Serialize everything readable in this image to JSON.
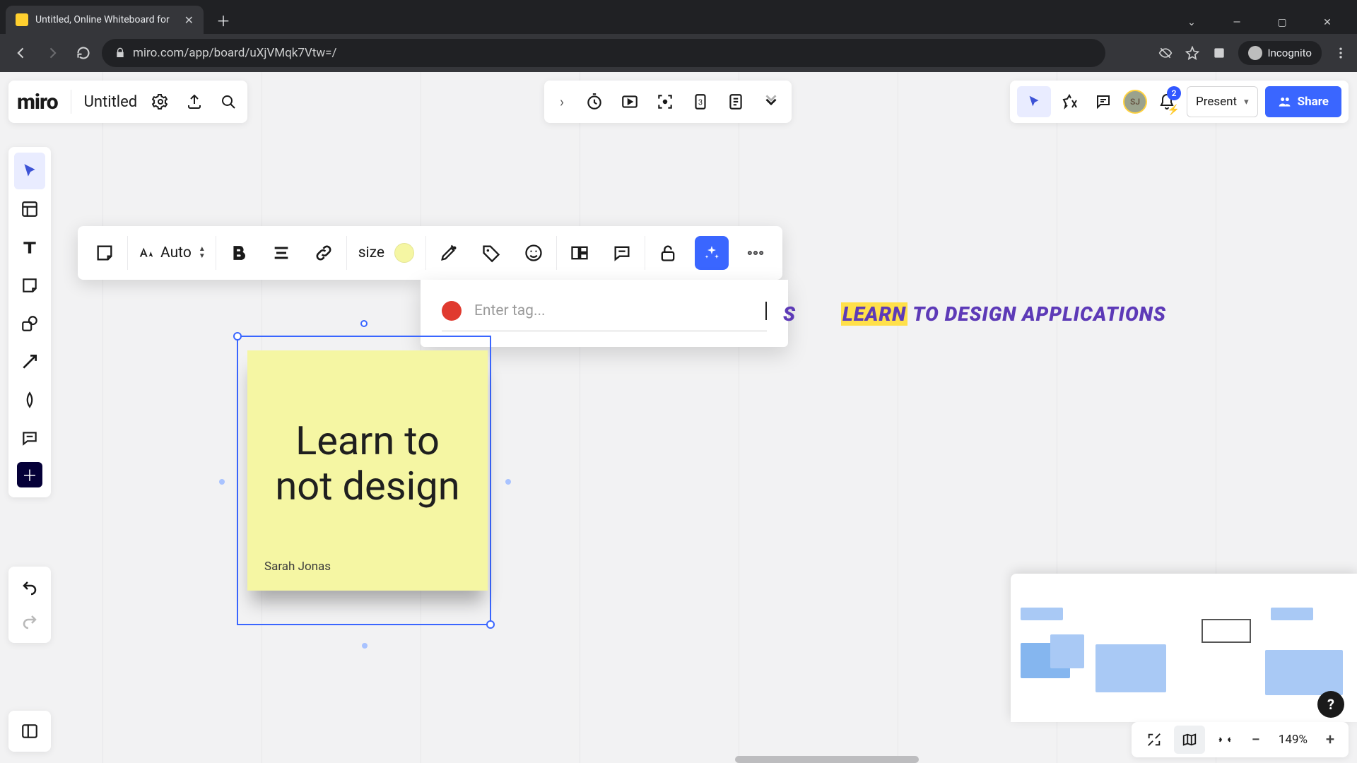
{
  "browser": {
    "tab_title": "Untitled, Online Whiteboard for",
    "url": "miro.com/app/board/uXjVMqk7Vtw=/",
    "incognito_label": "Incognito"
  },
  "header": {
    "logo_text": "miro",
    "board_title": "Untitled",
    "present_label": "Present",
    "share_label": "Share",
    "notification_count": "2",
    "avatar_initials": "SJ"
  },
  "context_bar": {
    "font_size_label": "Auto",
    "size_label": "size",
    "note_color": "#f5f6a3"
  },
  "tag_popover": {
    "placeholder": "Enter tag...",
    "dot_color": "#e03a2f"
  },
  "sticky": {
    "text": "Learn to not design",
    "author": "Sarah Jonas"
  },
  "canvas_text": {
    "right_a_suffix": "S",
    "right_b_highlight": "LEARN",
    "right_b_rest": " TO DESIGN APPLICATIONS"
  },
  "zoom": {
    "value": "149%"
  }
}
